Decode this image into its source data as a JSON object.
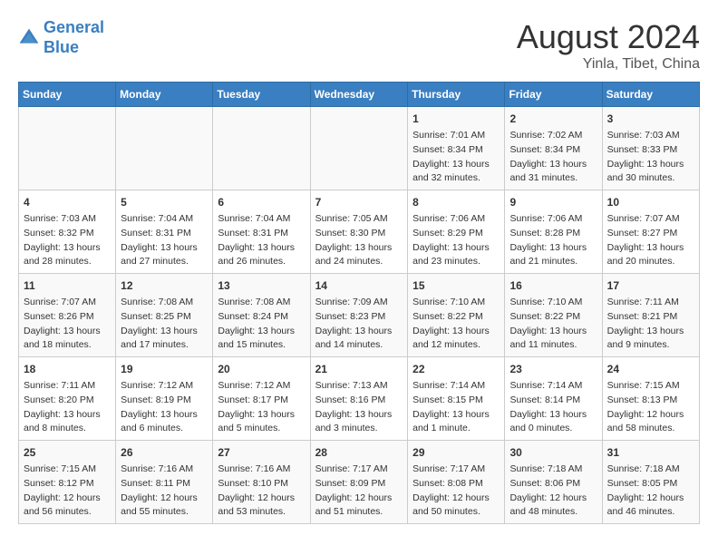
{
  "header": {
    "logo_line1": "General",
    "logo_line2": "Blue",
    "month": "August 2024",
    "location": "Yinla, Tibet, China"
  },
  "weekdays": [
    "Sunday",
    "Monday",
    "Tuesday",
    "Wednesday",
    "Thursday",
    "Friday",
    "Saturday"
  ],
  "weeks": [
    [
      {
        "day": "",
        "content": ""
      },
      {
        "day": "",
        "content": ""
      },
      {
        "day": "",
        "content": ""
      },
      {
        "day": "",
        "content": ""
      },
      {
        "day": "1",
        "content": "Sunrise: 7:01 AM\nSunset: 8:34 PM\nDaylight: 13 hours\nand 32 minutes."
      },
      {
        "day": "2",
        "content": "Sunrise: 7:02 AM\nSunset: 8:34 PM\nDaylight: 13 hours\nand 31 minutes."
      },
      {
        "day": "3",
        "content": "Sunrise: 7:03 AM\nSunset: 8:33 PM\nDaylight: 13 hours\nand 30 minutes."
      }
    ],
    [
      {
        "day": "4",
        "content": "Sunrise: 7:03 AM\nSunset: 8:32 PM\nDaylight: 13 hours\nand 28 minutes."
      },
      {
        "day": "5",
        "content": "Sunrise: 7:04 AM\nSunset: 8:31 PM\nDaylight: 13 hours\nand 27 minutes."
      },
      {
        "day": "6",
        "content": "Sunrise: 7:04 AM\nSunset: 8:31 PM\nDaylight: 13 hours\nand 26 minutes."
      },
      {
        "day": "7",
        "content": "Sunrise: 7:05 AM\nSunset: 8:30 PM\nDaylight: 13 hours\nand 24 minutes."
      },
      {
        "day": "8",
        "content": "Sunrise: 7:06 AM\nSunset: 8:29 PM\nDaylight: 13 hours\nand 23 minutes."
      },
      {
        "day": "9",
        "content": "Sunrise: 7:06 AM\nSunset: 8:28 PM\nDaylight: 13 hours\nand 21 minutes."
      },
      {
        "day": "10",
        "content": "Sunrise: 7:07 AM\nSunset: 8:27 PM\nDaylight: 13 hours\nand 20 minutes."
      }
    ],
    [
      {
        "day": "11",
        "content": "Sunrise: 7:07 AM\nSunset: 8:26 PM\nDaylight: 13 hours\nand 18 minutes."
      },
      {
        "day": "12",
        "content": "Sunrise: 7:08 AM\nSunset: 8:25 PM\nDaylight: 13 hours\nand 17 minutes."
      },
      {
        "day": "13",
        "content": "Sunrise: 7:08 AM\nSunset: 8:24 PM\nDaylight: 13 hours\nand 15 minutes."
      },
      {
        "day": "14",
        "content": "Sunrise: 7:09 AM\nSunset: 8:23 PM\nDaylight: 13 hours\nand 14 minutes."
      },
      {
        "day": "15",
        "content": "Sunrise: 7:10 AM\nSunset: 8:22 PM\nDaylight: 13 hours\nand 12 minutes."
      },
      {
        "day": "16",
        "content": "Sunrise: 7:10 AM\nSunset: 8:22 PM\nDaylight: 13 hours\nand 11 minutes."
      },
      {
        "day": "17",
        "content": "Sunrise: 7:11 AM\nSunset: 8:21 PM\nDaylight: 13 hours\nand 9 minutes."
      }
    ],
    [
      {
        "day": "18",
        "content": "Sunrise: 7:11 AM\nSunset: 8:20 PM\nDaylight: 13 hours\nand 8 minutes."
      },
      {
        "day": "19",
        "content": "Sunrise: 7:12 AM\nSunset: 8:19 PM\nDaylight: 13 hours\nand 6 minutes."
      },
      {
        "day": "20",
        "content": "Sunrise: 7:12 AM\nSunset: 8:17 PM\nDaylight: 13 hours\nand 5 minutes."
      },
      {
        "day": "21",
        "content": "Sunrise: 7:13 AM\nSunset: 8:16 PM\nDaylight: 13 hours\nand 3 minutes."
      },
      {
        "day": "22",
        "content": "Sunrise: 7:14 AM\nSunset: 8:15 PM\nDaylight: 13 hours\nand 1 minute."
      },
      {
        "day": "23",
        "content": "Sunrise: 7:14 AM\nSunset: 8:14 PM\nDaylight: 13 hours\nand 0 minutes."
      },
      {
        "day": "24",
        "content": "Sunrise: 7:15 AM\nSunset: 8:13 PM\nDaylight: 12 hours\nand 58 minutes."
      }
    ],
    [
      {
        "day": "25",
        "content": "Sunrise: 7:15 AM\nSunset: 8:12 PM\nDaylight: 12 hours\nand 56 minutes."
      },
      {
        "day": "26",
        "content": "Sunrise: 7:16 AM\nSunset: 8:11 PM\nDaylight: 12 hours\nand 55 minutes."
      },
      {
        "day": "27",
        "content": "Sunrise: 7:16 AM\nSunset: 8:10 PM\nDaylight: 12 hours\nand 53 minutes."
      },
      {
        "day": "28",
        "content": "Sunrise: 7:17 AM\nSunset: 8:09 PM\nDaylight: 12 hours\nand 51 minutes."
      },
      {
        "day": "29",
        "content": "Sunrise: 7:17 AM\nSunset: 8:08 PM\nDaylight: 12 hours\nand 50 minutes."
      },
      {
        "day": "30",
        "content": "Sunrise: 7:18 AM\nSunset: 8:06 PM\nDaylight: 12 hours\nand 48 minutes."
      },
      {
        "day": "31",
        "content": "Sunrise: 7:18 AM\nSunset: 8:05 PM\nDaylight: 12 hours\nand 46 minutes."
      }
    ]
  ]
}
